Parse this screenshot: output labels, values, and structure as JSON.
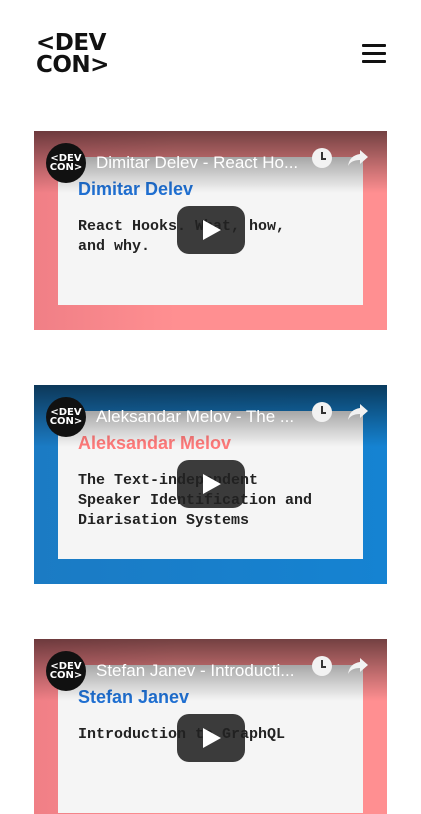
{
  "header": {
    "logo_line1": "<DEV",
    "logo_line2": "CON>"
  },
  "videos": [
    {
      "theme": "red",
      "title": "Dimitar Delev - React Ho...",
      "speaker": "Dimitar Delev",
      "speaker_color": "#1f6fd1",
      "talk": "React Hooks. What, how,\nand why."
    },
    {
      "theme": "blue",
      "title": "Aleksandar Melov - The ...",
      "speaker": "Aleksandar Melov",
      "speaker_color": "#ff7a7a",
      "talk": "The Text-independent\nSpeaker Identification and\nDiarisation Systems"
    },
    {
      "theme": "red",
      "title": "Stefan Janev - Introducti...",
      "speaker": "Stefan Janev",
      "speaker_color": "#1f6fd1",
      "talk": "Introduction to GraphQL"
    }
  ],
  "avatar_line1": "<DEV",
  "avatar_line2": "CON>",
  "icons": {
    "menu": "hamburger-menu-icon",
    "watch_later": "clock-icon",
    "share": "share-icon",
    "play": "play-icon"
  }
}
